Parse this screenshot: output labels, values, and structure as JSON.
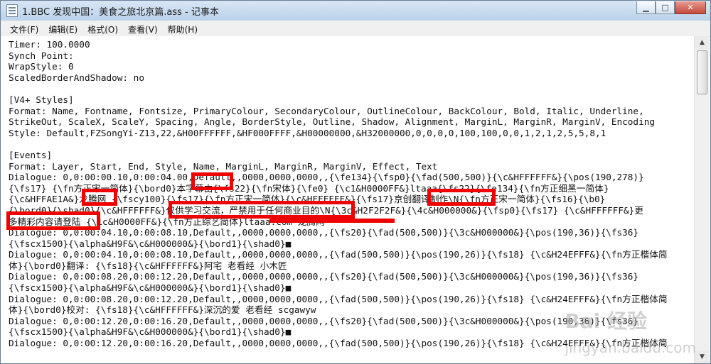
{
  "window": {
    "title": "1.BBC 发现中国：美食之旅北京篇.ass - 记事本"
  },
  "menu": [
    {
      "label": "文件(F)",
      "name": "menu-file"
    },
    {
      "label": "编辑(E)",
      "name": "menu-edit"
    },
    {
      "label": "格式(O)",
      "name": "menu-format"
    },
    {
      "label": "查看(V)",
      "name": "menu-view"
    },
    {
      "label": "帮助(H)",
      "name": "menu-help"
    }
  ],
  "editor": {
    "text": "Timer: 100.0000\nSynch Point:\nWrapStyle: 0\nScaledBorderAndShadow: no\n\n[V4+ Styles]\nFormat: Name, Fontname, Fontsize, PrimaryColour, SecondaryColour, OutlineColour, BackColour, Bold, Italic, Underline,\nStrikeOut, ScaleX, ScaleY, Spacing, Angle, BorderStyle, Outline, Shadow, Alignment, MarginL, MarginR, MarginV, Encoding\nStyle: Default,FZSongYi-Z13,22,&H00FFFFFF,&HF000FFFF,&H00000000,&H32000000,0,0,0,0,100,100,0,0,1,2,1,2,5,5,8,1\n\n[Events]\nFormat: Layer, Start, End, Style, Name, MarginL, MarginR, MarginV, Effect, Text\nDialogue: 0,0:00:00.10,0:00:04.00,Default,,0000,0000,0000,,{\\fe134}{\\fsp0}{\\fad(500,500)}{\\c&HFFFFFF&}{\\pos(190,278)}\n{\\fs17} {\\fn方正宋一简体}{\\bord0}本字幕由{\\fs22}{\\fn宋体}{\\fe0} {\\c1&H0000FF&}ltaaa{\\fs22}{\\fe134}{\\fn方正细黑一简体}\n{\\c&HFFAE1A&}龙腾网 {\\fscy100}{\\fs17}{\\fn方正宋一简体}{\\c&HFFFFFF&}{\\fs17}京创翻译制作\\N{\\fn方正宋一简体}{\\fs16}{\\b0}\n{\\bord0}{\\shad0}{\\c&HFFFFFF&}仅供学习交流，严禁用于任何商业目的\\N{\\3c&H2F2F2F&}{\\4c&H000000&}{\\fsp0}{\\fs17} {\\c&HFFFFFF&}更\n多精彩内容请登陆 {\\1c&H0000FF&}{\\fn方正综艺简体}ltaaa.com 龙腾网\nDialogue: 0,0:00:04.10,0:00:08.10,Default,,0000,0000,0000,,{\\fs20}{\\fad(500,500)}{\\3c&H000000&}{\\pos(190,36)}{\\fs36}\n{\\fscx1500}{\\alpha&H9F&\\c&H000000&}{\\bord1}{\\shad0}■\nDialogue: 0,0:00:04.10,0:00:08.10,Default,,0000,0000,0000,,{\\fad(500,500)}{\\pos(190,26)}{\\fs18} {\\c&H24EFFF&}{\\fn方正楷体简\n体}{\\bord0}翻译: {\\fs18}{\\c&HFFFFFF&}阿宅 老看经 小木匠\nDialogue: 0,0:00:08.20,0:00:12.20,Default,,0000,0000,0000,,{\\fs20}{\\fad(500,500)}{\\3c&H000000&}{\\pos(190,36)}{\\fs36}\n{\\fscx1500}{\\alpha&H9F&\\c&H000000&}{\\bord1}{\\shad0}■\nDialogue: 0,0:00:08.20,0:00:12.20,Default,,0000,0000,0000,,{\\fad(500,500)}{\\pos(190,26)}{\\fs18} {\\c&H24EFFF&}{\\fn方正楷体简\n体}{\\bord0}校对: {\\fs18}{\\c&HFFFFFF&}深沉的爱 老看经 scgawyw\nDialogue: 0,0:00:12.20,0:00:16.20,Default,,0000,0000,0000,,{\\fs20}{\\fad(500,500)}{\\3c&H000000&}{\\pos(190,36)}{\\fs36}\n{\\fscx1500}{\\alpha&H9F&\\c&H000000&}{\\bord1}{\\shad0}■\nDialogue: 0,0:00:12.20,0:00:16.20,Default,,0000,0000,0000,,{\\fad(500,500)}{\\pos(190,26)}{\\fs18} {\\c&H24EFFF&}{\\fn方正楷体简"
  },
  "colors": {
    "redaction": "#ee0000",
    "titlebar": "#c8dbef"
  },
  "watermark": {
    "brand": "Bai 经验",
    "sub": "jingyan.baidu.com"
  }
}
